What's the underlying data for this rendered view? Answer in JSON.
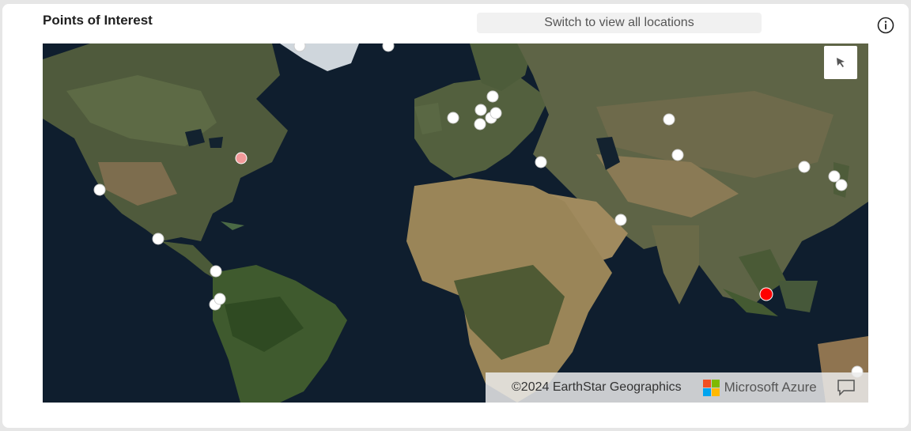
{
  "header": {
    "title": "Points of Interest",
    "switch_label": "Switch to view all locations"
  },
  "icons": {
    "info": "info-icon",
    "select_tool": "cursor-select-icon",
    "feedback": "feedback-icon"
  },
  "map": {
    "style": "satellite",
    "attribution": "©2024 EarthStar Geographics",
    "provider": "Microsoft Azure",
    "pin_colors": {
      "default": "#ffffff",
      "highlight": "#ff0000",
      "soft_highlight": "#f29a9a"
    },
    "logo_colors": [
      "#f25022",
      "#7fba00",
      "#00a4ef",
      "#ffb900"
    ]
  }
}
